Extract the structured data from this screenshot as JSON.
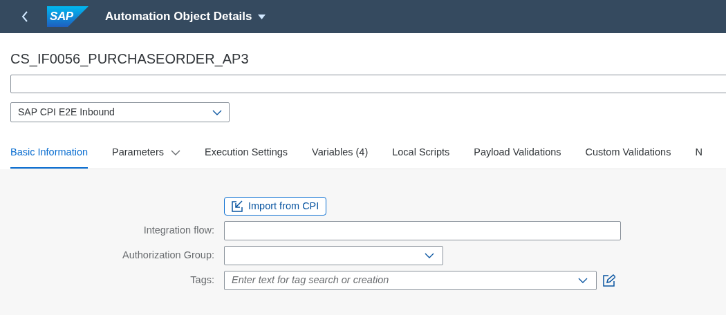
{
  "shell": {
    "logo": "SAP",
    "title": "Automation Object Details"
  },
  "object": {
    "title": "CS_IF0056_PURCHASEORDER_AP3",
    "type_select": "SAP CPI E2E Inbound"
  },
  "tabs": [
    {
      "label": "Basic Information",
      "selected": true,
      "kind": "plain"
    },
    {
      "label": "Parameters",
      "selected": false,
      "kind": "menu"
    },
    {
      "label": "Execution Settings",
      "selected": false,
      "kind": "plain"
    },
    {
      "label": "Variables (4)",
      "selected": false,
      "kind": "plain"
    },
    {
      "label": "Local Scripts",
      "selected": false,
      "kind": "plain"
    },
    {
      "label": "Payload Validations",
      "selected": false,
      "kind": "plain"
    },
    {
      "label": "Custom Validations",
      "selected": false,
      "kind": "plain"
    },
    {
      "label": "N",
      "selected": false,
      "kind": "plain"
    }
  ],
  "form": {
    "import_button": "Import from CPI",
    "fields": [
      {
        "label": "Integration flow:",
        "kind": "input"
      },
      {
        "label": "Authorization Group:",
        "kind": "select"
      },
      {
        "label": "Tags:",
        "kind": "tags",
        "placeholder": "Enter text for tag search or creation"
      }
    ]
  }
}
